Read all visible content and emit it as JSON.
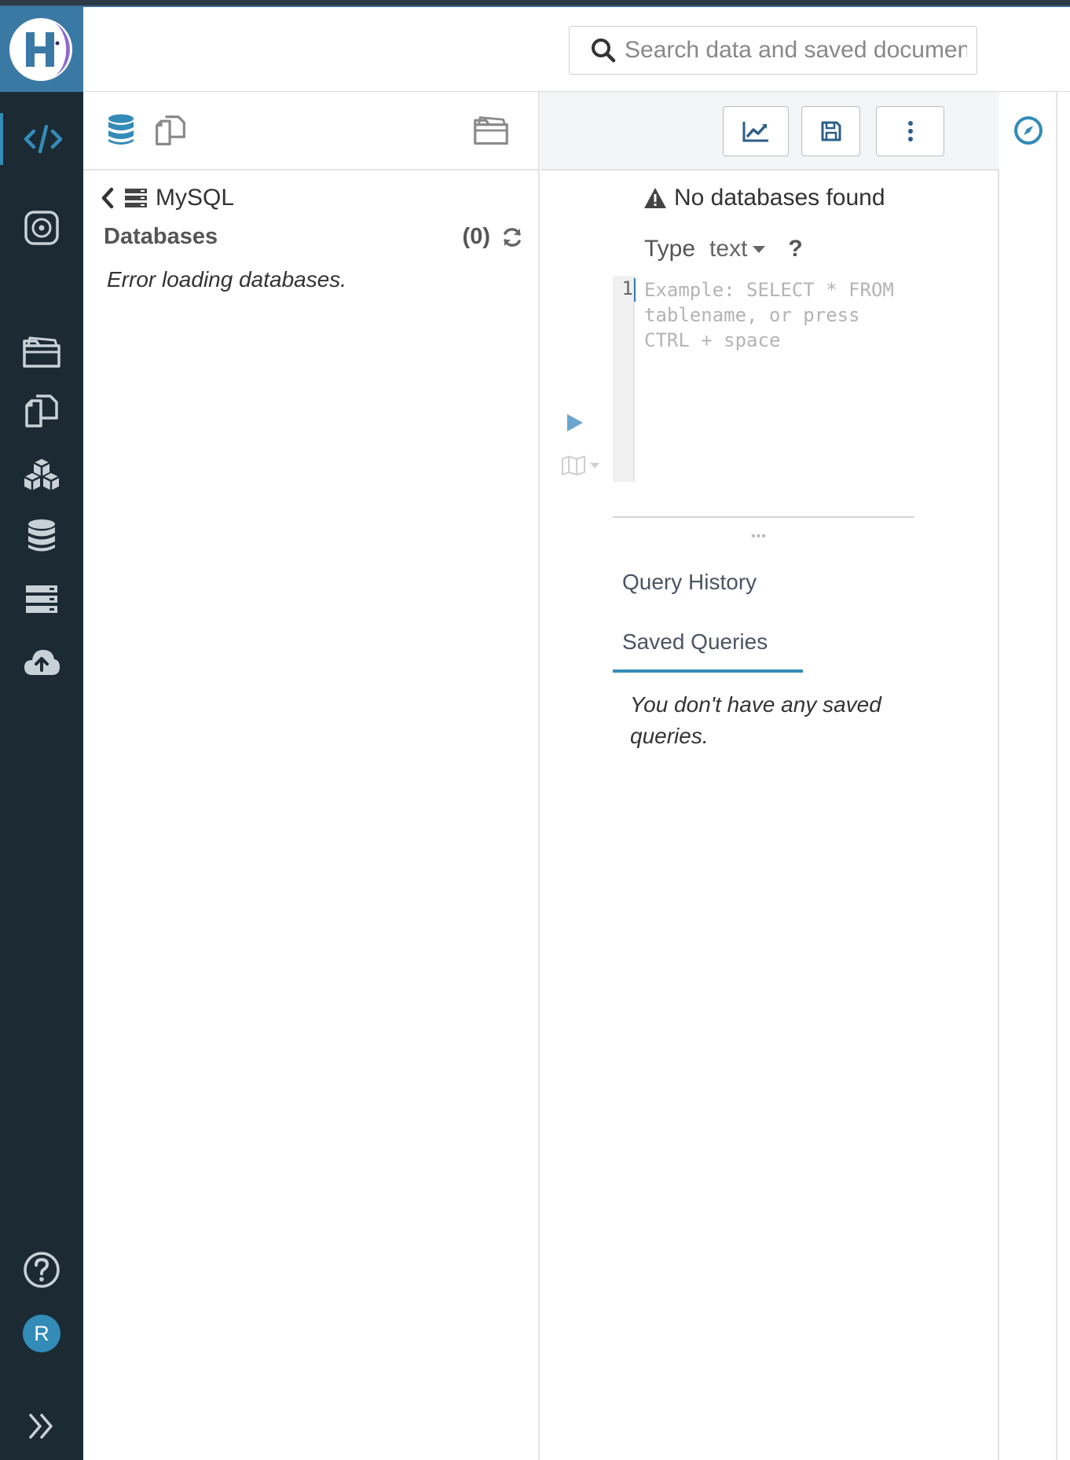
{
  "colors": {
    "nav_bg": "#1b2a33",
    "logo_bg": "#3b79a5",
    "accent": "#338bb8",
    "nav_icon": "#c8d1d8"
  },
  "header": {
    "search_placeholder": "Search data and saved documents..."
  },
  "left_nav": {
    "items": [
      {
        "name": "editor-nav",
        "icon": "code-icon",
        "active": true
      },
      {
        "name": "dashboard-nav",
        "icon": "target-icon"
      },
      {
        "name": "documents-nav",
        "icon": "folder-open-icon"
      },
      {
        "name": "files-nav",
        "icon": "copy-icon"
      },
      {
        "name": "tables-nav",
        "icon": "cubes-icon"
      },
      {
        "name": "databases-nav",
        "icon": "database-icon"
      },
      {
        "name": "hbase-nav",
        "icon": "server-icon"
      },
      {
        "name": "importer-nav",
        "icon": "cloud-upload-icon"
      }
    ],
    "help_icon": "question-circle-icon",
    "user_initial": "R",
    "collapse_icon": "double-chevron-right-icon"
  },
  "assist": {
    "source": "MySQL",
    "databases_label": "Databases",
    "count": "(0)",
    "error": "Error loading databases."
  },
  "editor": {
    "warning": "No databases found",
    "type_label": "Type",
    "type_value": "text",
    "help_mark": "?",
    "line_number": "1",
    "placeholder": "Example: SELECT * FROM\ntablename, or press\nCTRL + space",
    "grip": "•••",
    "tabs": [
      "Query History",
      "Saved Queries"
    ],
    "active_tab": "Saved Queries",
    "empty_message": "You don't have any saved queries."
  }
}
